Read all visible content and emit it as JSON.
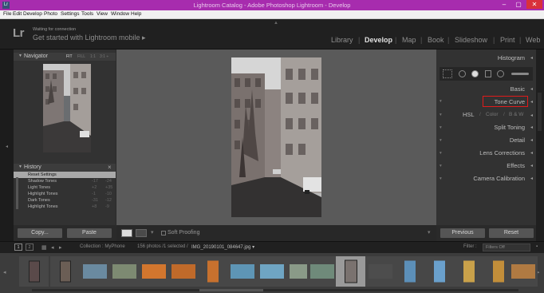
{
  "window": {
    "title": "Lightroom Catalog - Adobe Photoshop Lightroom - Develop",
    "icon": "Lr",
    "minimize": "–",
    "maximize": "▢",
    "close": "✕"
  },
  "menu": [
    "File",
    "Edit",
    "Develop",
    "Photo",
    "Settings",
    "Tools",
    "View",
    "Window",
    "Help"
  ],
  "identity": {
    "logo": "Lr",
    "status": "Waiting for connection",
    "message": "Get started with Lightroom mobile ▸"
  },
  "modules": [
    "Library",
    "Develop",
    "Map",
    "Book",
    "Slideshow",
    "Print",
    "Web"
  ],
  "active_module": "Develop",
  "navigator": {
    "title": "Navigator",
    "zoom_options": [
      "FIT",
      "FILL",
      "1:1",
      "3:1 ÷"
    ]
  },
  "history": {
    "title": "History",
    "close": "×",
    "items": [
      {
        "label": "Reset Settings",
        "v1": "",
        "v2": ""
      },
      {
        "label": "Shadow Tones",
        "v1": "-17",
        "v2": "-24"
      },
      {
        "label": "Light Tones",
        "v1": "+2",
        "v2": "+35"
      },
      {
        "label": "Highlight Tones",
        "v1": "-1",
        "v2": "-10"
      },
      {
        "label": "Dark Tones",
        "v1": "-31",
        "v2": "-12"
      },
      {
        "label": "Highlight Tones",
        "v1": "+8",
        "v2": "-9"
      }
    ]
  },
  "left_buttons": {
    "copy": "Copy...",
    "paste": "Paste"
  },
  "toolbar": {
    "soft_proofing": "Soft Proofing",
    "dropdown": "▾"
  },
  "right_panel": {
    "histogram": "Histogram",
    "basic": "Basic",
    "tone_curve": "Tone Curve",
    "hsl": "HSL",
    "color": "Color",
    "bw": "B & W",
    "split_toning": "Split Toning",
    "detail": "Detail",
    "lens_corrections": "Lens Corrections",
    "effects": "Effects",
    "camera_calibration": "Camera Calibration"
  },
  "right_buttons": {
    "previous": "Previous",
    "reset": "Reset"
  },
  "filmstrip_bar": {
    "pages": [
      "1",
      "2"
    ],
    "source": "Collection : MyPhone",
    "count": "156 photos /1 selected /",
    "filename": "IMG_20190101_084647.jpg ▾",
    "filter_label": "Filter :",
    "filter_value": "Filters Off"
  },
  "colors": {
    "titlebar": "#a72cae",
    "highlight_box": "#e01b1b",
    "panel_bg": "#323232",
    "viewer_bg": "#5a5a5a"
  }
}
